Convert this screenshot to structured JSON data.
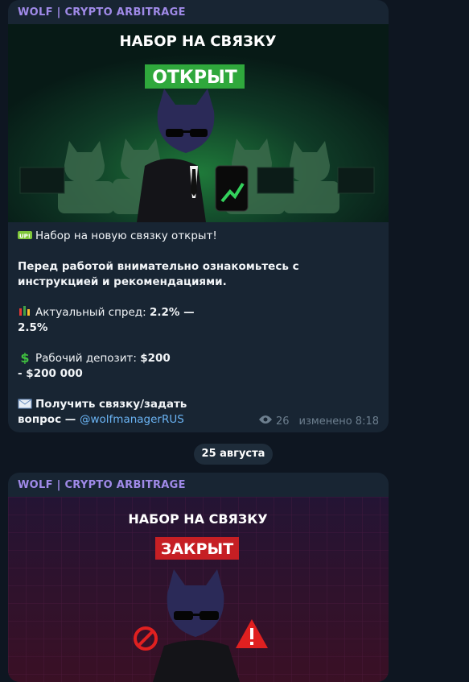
{
  "messages": [
    {
      "channel": "WOLF | CRYPTO ARBITRAGE",
      "banner": {
        "title": "НАБОР НА СВЯЗКУ",
        "status": "ОТКРЫТ",
        "status_color": "#2fa83c",
        "theme": "green"
      },
      "text": {
        "line1": "Набор на новую связку открыт!",
        "line2": "Перед работой внимательно ознакомьтесь с инструкцией и рекомендациями.",
        "spread_label": "Актуальный спред: ",
        "spread_value": "2.2% — 2.5%",
        "deposit_label": "Рабочий депозит: ",
        "deposit_value": "$200 - $200 000",
        "contact_label": "Получить связку/задать вопрос — ",
        "contact_link": "@wolfmanagerRUS"
      },
      "views": "26",
      "edited": "изменено 8:18"
    },
    {
      "channel": "WOLF | CRYPTO ARBITRAGE",
      "banner": {
        "title": "НАБОР НА СВЯЗКУ",
        "status": "ЗАКРЫТ",
        "status_color": "#c61f24",
        "theme": "red"
      }
    }
  ],
  "date_separator": "25 августа"
}
